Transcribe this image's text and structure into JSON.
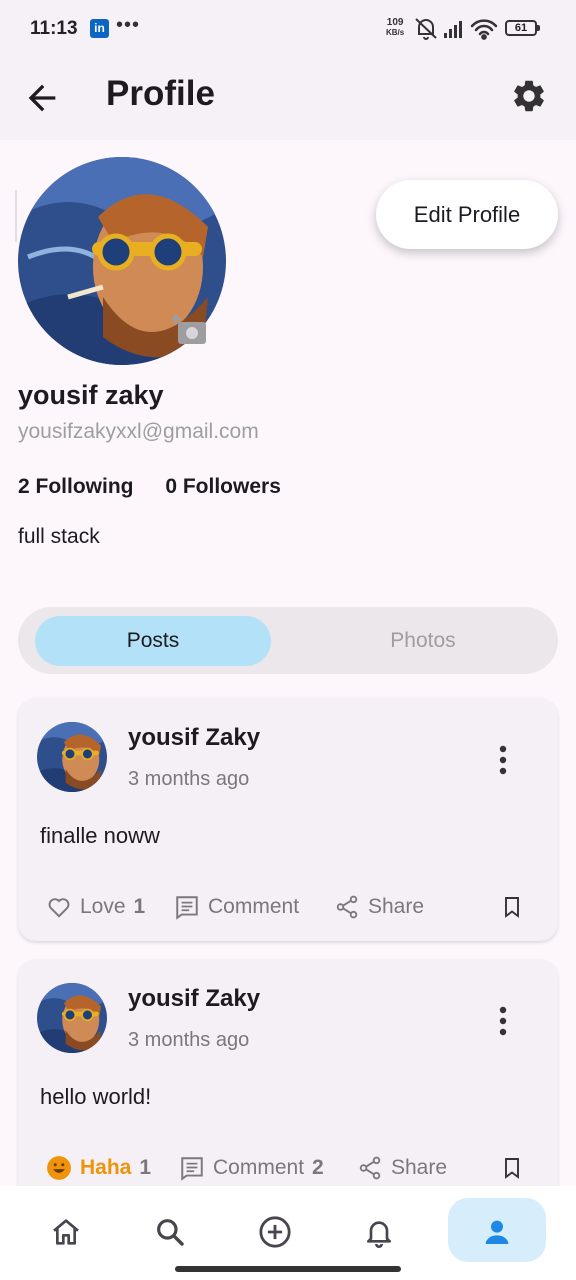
{
  "status_bar": {
    "time": "11:13",
    "linkedin_badge": "in",
    "overflow_dots": "•••",
    "net_speed_value": "109",
    "net_speed_unit": "KB/s",
    "battery": "61"
  },
  "app_bar": {
    "title": "Profile",
    "back_icon": "arrow-back-icon",
    "settings_icon": "gear-icon"
  },
  "profile": {
    "name": "yousif zaky",
    "email": "yousifzakyxxl@gmail.com",
    "following": "2 Following",
    "followers": "0 Followers",
    "bio": "full stack",
    "edit_button": "Edit Profile"
  },
  "tabs": [
    {
      "label": "Posts",
      "active": true
    },
    {
      "label": "Photos",
      "active": false
    }
  ],
  "posts": [
    {
      "author": "yousif Zaky",
      "time": "3 months ago",
      "text": "finalle noww",
      "reaction_label": "Love",
      "reaction_count": "1",
      "comment_label": "Comment",
      "comment_count": "",
      "share_label": "Share"
    },
    {
      "author": "yousif Zaky",
      "time": "3 months ago",
      "text": "hello world!",
      "reaction_label": "Haha",
      "reaction_count": "1",
      "comment_label": "Comment",
      "comment_count": "2",
      "share_label": "Share"
    }
  ],
  "bottom_nav": [
    {
      "icon": "home-icon",
      "active": false
    },
    {
      "icon": "search-icon",
      "active": false
    },
    {
      "icon": "add-circle-icon",
      "active": false
    },
    {
      "icon": "bell-icon",
      "active": false
    },
    {
      "icon": "person-icon",
      "active": true
    }
  ],
  "colors": {
    "accent": "#1e88e5",
    "tab_active": "#b3e2f8",
    "haha": "#f0930b"
  }
}
